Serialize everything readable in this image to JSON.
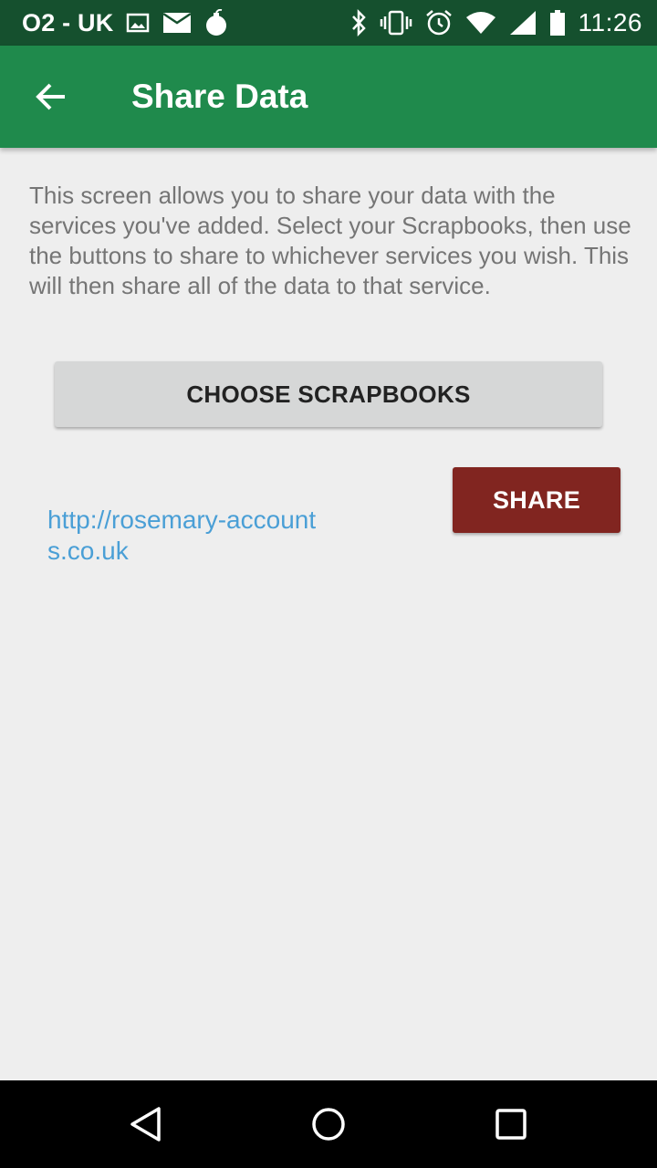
{
  "status_bar": {
    "carrier": "O2 - UK",
    "time": "11:26",
    "left_icons": [
      "image-icon",
      "mail-icon",
      "bomb-icon"
    ],
    "right_icons": [
      "bluetooth-icon",
      "vibrate-icon",
      "alarm-icon",
      "wifi-icon",
      "signal-icon",
      "battery-icon"
    ]
  },
  "app_bar": {
    "back_icon": "arrow-left-icon",
    "title": "Share Data",
    "background": "#1f8a4c"
  },
  "main": {
    "description": "This screen allows you to share your data with the services you've added. Select your Scrapbooks, then use the buttons to share to whichever services you wish. This will then share all of the data to that service.",
    "choose_button_label": "CHOOSE SCRAPBOOKS",
    "services": [
      {
        "url": "http://rosemary-accounts.co.uk",
        "share_label": "SHARE"
      }
    ]
  },
  "nav_bar": {
    "icons": [
      "back-triangle-icon",
      "home-circle-icon",
      "recents-square-icon"
    ]
  },
  "colors": {
    "status_bar": "#15502e",
    "accent_green": "#1f8a4c",
    "share_button": "#812520",
    "link": "#4a9fd6"
  }
}
